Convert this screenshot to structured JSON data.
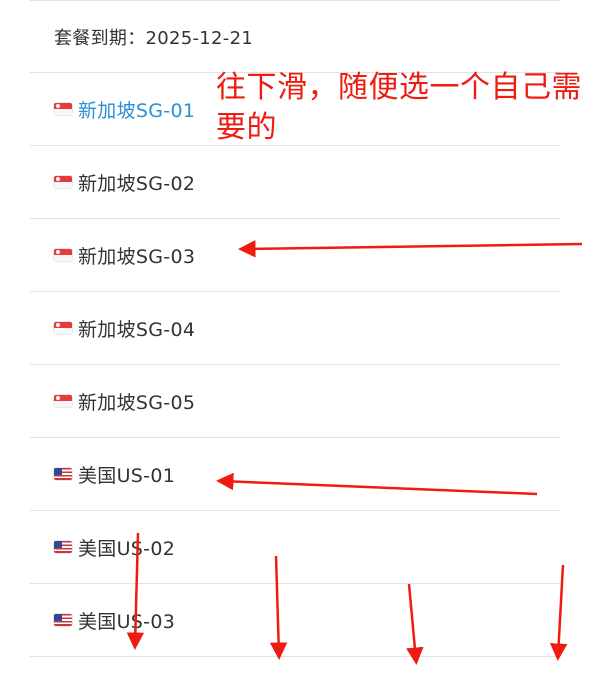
{
  "header": {
    "expiry_text": "套餐到期：2025-12-21"
  },
  "servers": [
    {
      "flag": "sg-flag-icon",
      "name": "新加坡SG-01",
      "selected": true
    },
    {
      "flag": "sg-flag-icon",
      "name": "新加坡SG-02",
      "selected": false
    },
    {
      "flag": "sg-flag-icon",
      "name": "新加坡SG-03",
      "selected": false
    },
    {
      "flag": "sg-flag-icon",
      "name": "新加坡SG-04",
      "selected": false
    },
    {
      "flag": "sg-flag-icon",
      "name": "新加坡SG-05",
      "selected": false
    },
    {
      "flag": "us-flag-icon",
      "name": "美国US-01",
      "selected": false
    },
    {
      "flag": "us-flag-icon",
      "name": "美国US-02",
      "selected": false
    },
    {
      "flag": "us-flag-icon",
      "name": "美国US-03",
      "selected": false
    }
  ],
  "annotation": {
    "text": "往下滑，随便选一个自己需要的"
  },
  "colors": {
    "annotation": "#f01b10",
    "selected": "#2a90d8",
    "text": "#333333",
    "divider": "#e2e2e2"
  }
}
